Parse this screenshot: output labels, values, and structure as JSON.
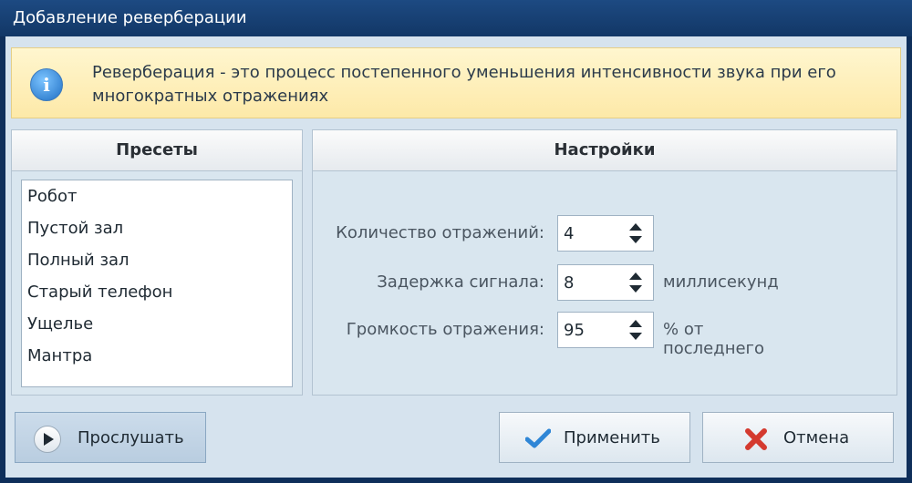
{
  "window": {
    "title": "Добавление реверберации"
  },
  "info": {
    "text": "Реверберация - это процесс постепенного уменьшения интенсивности звука при его многократных отражениях"
  },
  "presets": {
    "header": "Пресеты",
    "items": [
      "Робот",
      "Пустой зал",
      "Полный зал",
      "Старый телефон",
      "Ущелье",
      "Мантра"
    ]
  },
  "settings": {
    "header": "Настройки",
    "reflections": {
      "label": "Количество отражений:",
      "value": "4"
    },
    "delay": {
      "label": "Задержка сигнала:",
      "value": "8",
      "unit": "миллисекунд"
    },
    "volume": {
      "label": "Громкость отражения:",
      "value": "95",
      "unit": "% от последнего"
    }
  },
  "buttons": {
    "play": "Прослушать",
    "apply": "Применить",
    "cancel": "Отмена"
  },
  "icons": {
    "info": "info-icon",
    "play": "play-icon",
    "apply": "check-icon",
    "cancel": "close-icon"
  },
  "colors": {
    "titlebar": "#123766",
    "info_background": "#fde9a8",
    "panel_background": "#d9e6ef",
    "cancel_icon": "#d43a2f",
    "apply_icon": "#2f86d6"
  }
}
